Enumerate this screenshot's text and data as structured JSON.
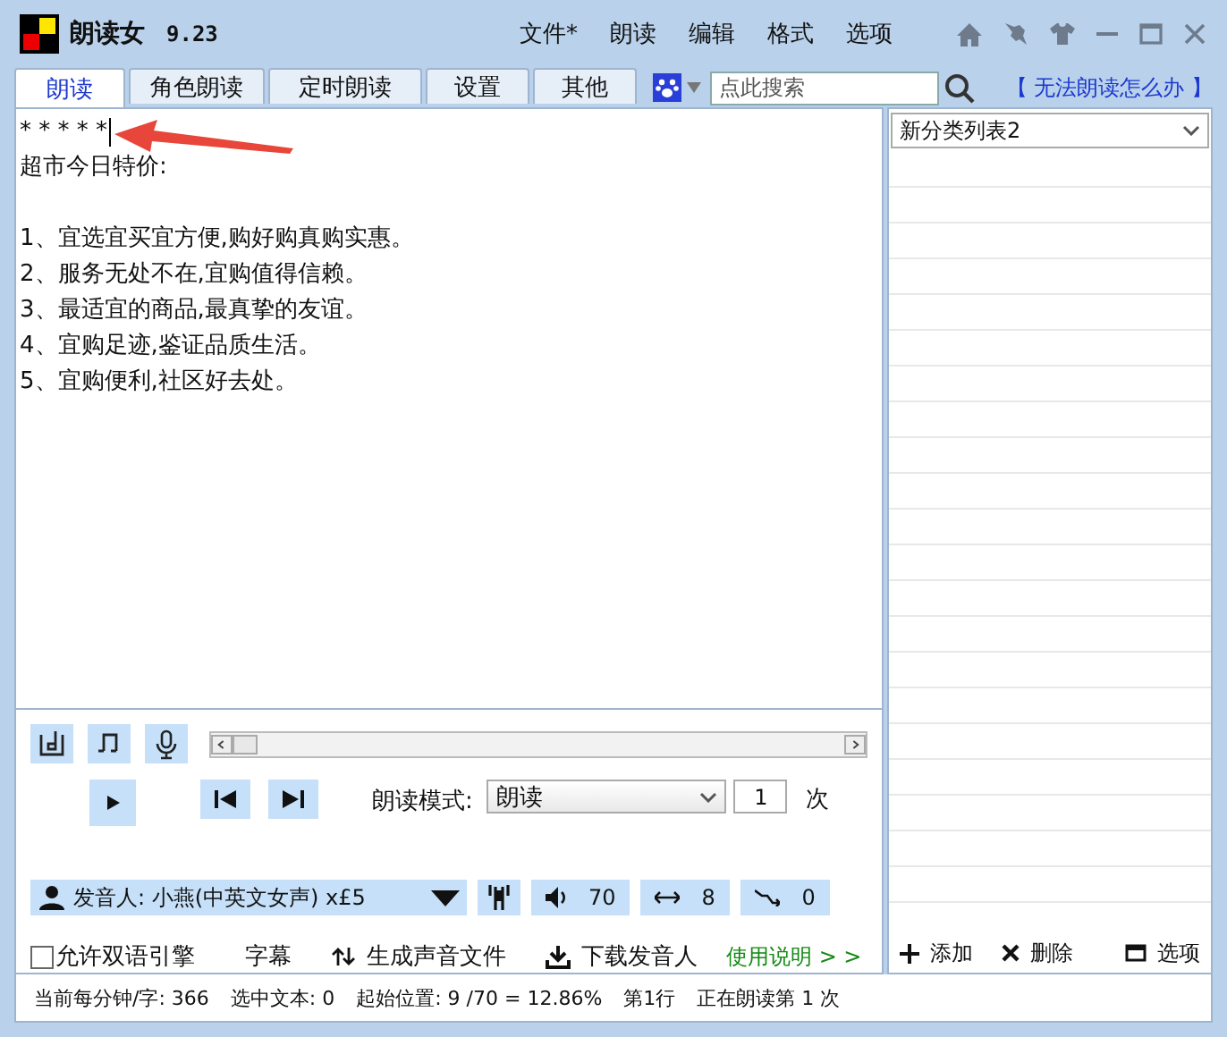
{
  "app": {
    "title": "朗读女",
    "version": "9.23"
  },
  "menu": [
    "文件*",
    "朗读",
    "编辑",
    "格式",
    "选项"
  ],
  "tabs": [
    {
      "label": "朗读",
      "selected": true
    },
    {
      "label": "角色朗读",
      "selected": false
    },
    {
      "label": "定时朗读",
      "selected": false
    },
    {
      "label": "设置",
      "selected": false
    },
    {
      "label": "其他",
      "selected": false
    }
  ],
  "search": {
    "placeholder": "点此搜索"
  },
  "help_link": "【 无法朗读怎么办 】",
  "editor": {
    "heading": [
      "* * * * *",
      "超市今日特价:"
    ],
    "items": [
      "1、宜选宜买宜方便,购好购真购实惠。",
      "2、服务无处不在,宜购值得信赖。",
      "3、最适宜的商品,最真挚的友谊。",
      "4、宜购足迹,鉴证品质生活。",
      "5、宜购便利,社区好去处。"
    ]
  },
  "player": {
    "mode_label": "朗读模式:",
    "mode": "朗读",
    "repeat": "1",
    "repeat_unit": "次"
  },
  "voice": {
    "name": "发音人: 小燕(中英文女声) x£5",
    "volume": "70",
    "speed": "8",
    "pitch": "0"
  },
  "options": {
    "checkbox": {
      "label": "允许双语引擎",
      "checked": false
    },
    "subtitle": "字幕",
    "make_audio": "生成声音文件",
    "download": "下载发音人",
    "help": "使用说明 > >"
  },
  "side": {
    "list": "新分类列表2",
    "add": "添加",
    "delete": "删除",
    "options": "选项"
  },
  "status": [
    "当前每分钟/字: 366",
    "选中文本: 0",
    "起始位置: 9 /70 = 12.86%",
    "第1行",
    "正在朗读第 1 次"
  ]
}
